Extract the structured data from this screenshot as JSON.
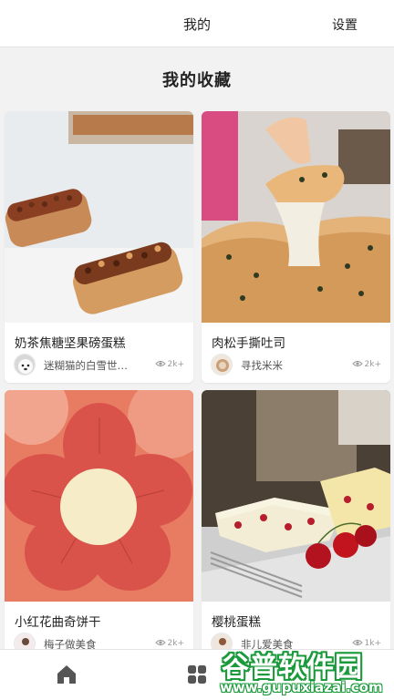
{
  "header": {
    "title": "我的",
    "settings_label": "设置"
  },
  "section": {
    "title": "我的收藏"
  },
  "recipes": [
    {
      "name": "奶茶焦糖坚果磅蛋糕",
      "author": "迷糊猫的白雪世…",
      "views": "2k+",
      "image_icon": "pound-cake-photo",
      "avatar_icon": "dog-avatar"
    },
    {
      "name": "肉松手撕吐司",
      "author": "寻找米米",
      "views": "2k+",
      "image_icon": "toast-bread-photo",
      "avatar_icon": "food-avatar"
    },
    {
      "name": "小红花曲奇饼干",
      "author": "梅子做美食",
      "views": "2k+",
      "image_icon": "flower-cookie-photo",
      "avatar_icon": "person-avatar"
    },
    {
      "name": "樱桃蛋糕",
      "author": "非儿爱美食",
      "views": "1k+",
      "image_icon": "cherry-cake-photo",
      "avatar_icon": "person-avatar"
    }
  ],
  "nav": {
    "items": [
      {
        "icon": "home-icon"
      },
      {
        "icon": "grid-icon"
      }
    ]
  },
  "watermark": {
    "brand": "谷普软件园",
    "url": "www.gupuxiazai.com"
  },
  "colors": {
    "background": "#f2f2f2",
    "card": "#ffffff",
    "text": "#222222",
    "muted": "#999999",
    "watermark_green": "#1a9a3a"
  }
}
